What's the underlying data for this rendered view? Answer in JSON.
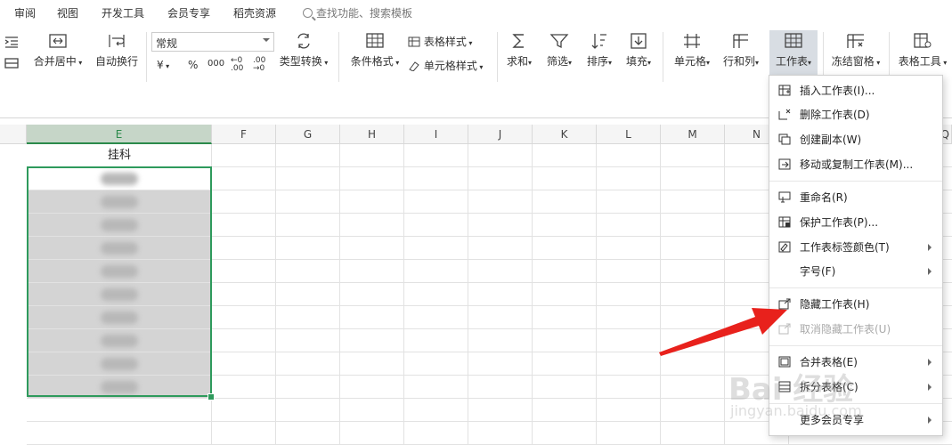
{
  "menubar": {
    "items": [
      "审阅",
      "视图",
      "开发工具",
      "会员专享",
      "稻壳资源"
    ],
    "search_placeholder": "查找功能、搜索模板"
  },
  "ribbon": {
    "merge_center": "合并居中",
    "auto_wrap": "自动换行",
    "number_format": "常规",
    "currency_symbol": "¥",
    "percent_symbol": "%",
    "thousands_symbol": "000",
    "dec_inc": "←0 .00",
    "dec_dec": ".00 →0",
    "type_convert": "类型转换",
    "cond_format": "条件格式",
    "table_style": "表格样式",
    "cell_style": "单元格样式",
    "sum": "求和",
    "filter": "筛选",
    "sort": "排序",
    "fill": "填充",
    "cell": "单元格",
    "row_col": "行和列",
    "worksheet": "工作表",
    "freeze": "冻结窗格",
    "table_tools": "表格工具"
  },
  "sheet": {
    "columns": [
      "E",
      "F",
      "G",
      "H",
      "I",
      "J",
      "K",
      "L",
      "M",
      "N"
    ],
    "partial_column": "Q",
    "header_cell": "挂科"
  },
  "dropdown": {
    "items": [
      {
        "label": "插入工作表(I)...",
        "icon": "insert-sheet-icon",
        "enabled": true,
        "submenu": false
      },
      {
        "label": "删除工作表(D)",
        "icon": "delete-sheet-icon",
        "enabled": true,
        "submenu": false
      },
      {
        "label": "创建副本(W)",
        "icon": "copy-sheet-icon",
        "enabled": true,
        "submenu": false
      },
      {
        "label": "移动或复制工作表(M)...",
        "icon": "move-sheet-icon",
        "enabled": true,
        "submenu": false
      },
      {
        "label": "重命名(R)",
        "icon": "rename-icon",
        "enabled": true,
        "submenu": false
      },
      {
        "label": "保护工作表(P)...",
        "icon": "protect-sheet-icon",
        "enabled": true,
        "submenu": false
      },
      {
        "label": "工作表标签颜色(T)",
        "icon": "tab-color-icon",
        "enabled": true,
        "submenu": true
      },
      {
        "label": "字号(F)",
        "icon": "",
        "enabled": true,
        "submenu": true
      },
      {
        "label": "隐藏工作表(H)",
        "icon": "hide-sheet-icon",
        "enabled": true,
        "submenu": false
      },
      {
        "label": "取消隐藏工作表(U)",
        "icon": "unhide-sheet-icon",
        "enabled": false,
        "submenu": false
      },
      {
        "label": "合并表格(E)",
        "icon": "merge-table-icon",
        "enabled": true,
        "submenu": true
      },
      {
        "label": "拆分表格(C)",
        "icon": "split-table-icon",
        "enabled": true,
        "submenu": true
      },
      {
        "label": "更多会员专享",
        "icon": "",
        "enabled": true,
        "submenu": true
      }
    ]
  },
  "watermark": {
    "main": "Bai 经验",
    "sub": "jingyan.baidu.com"
  },
  "colors": {
    "accent": "#2e9a5c",
    "arrow": "#e8211c"
  }
}
